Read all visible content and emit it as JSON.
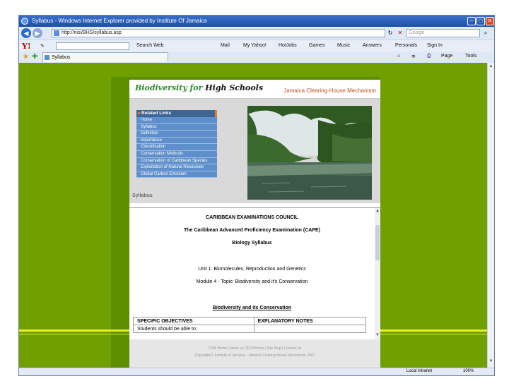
{
  "browser": {
    "title": "Syllabus - Windows Internet Explorer provided by Institute Of Jamaica",
    "address": "http://nisi/BHS/syllabus.asp",
    "search_placeholder": "Google",
    "tab_label": "Syllabus",
    "page_menu": "Page",
    "tools_menu": "Tools"
  },
  "yahoo_toolbar": {
    "logo": "Y!",
    "search_web": "Search Web",
    "items": [
      "Mail",
      "My Yahoo!",
      "HotJobs",
      "Games",
      "Music",
      "Answers",
      "Personals",
      "Sign In"
    ]
  },
  "status": {
    "zone": "Local intranet",
    "zoom": "100%"
  },
  "page": {
    "logo_line1": "Biodiversity for",
    "logo_line2": "High Schools",
    "chm_title": "Jamaica Clearing-House Mechanism",
    "related_links_header": "Related Links",
    "related_links": [
      "Home",
      "Syllabus",
      "Definition",
      "Importance",
      "Classification",
      "Conservation Methods",
      "Conservation of Caribbean Species",
      "Exploitation of Natural Resources",
      "Global Carbon Emission"
    ],
    "section_label": "Syllabus",
    "council": "CARIBBEAN EXAMINATIONS COUNCIL",
    "exam": "The Caribbean Advanced Proficiency Examination (CAPE)",
    "syllabus": "Biology Syllabus",
    "unit": "Unit 1: Biomolecules, Reproduction and Genetics",
    "module": "Module 4  -  Topic: Biodiversity and it's Conservation",
    "heading": "Biodiversity and its Conservation",
    "table_headers": [
      "SPECIFIC OBJECTIVES",
      "EXPLANATORY NOTES"
    ],
    "table_row1": "Students should be able to:",
    "footer_links": "CHM Home | About us | BCH Home | Site Map | Contact Us",
    "copyright": "Copyright © Institute of Jamaica - Jamaica Clearing-House Mechanism 2007"
  }
}
